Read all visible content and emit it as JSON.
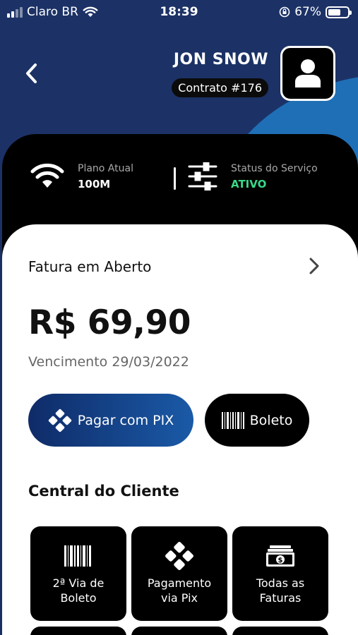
{
  "status_bar": {
    "carrier": "Claro BR",
    "time": "18:39",
    "battery": "67%",
    "battery_level": 0.67
  },
  "header": {
    "user_name": "JON SNOW",
    "contract": "Contrato #176",
    "back_icon": "chevron-left-icon",
    "avatar_icon": "user-icon"
  },
  "service_info": {
    "plan_label": "Plano Atual",
    "plan_value": "100M",
    "status_label": "Status do Serviço",
    "status_value": "ATIVO",
    "status_color": "#39d98a"
  },
  "invoice": {
    "title": "Fatura em Aberto",
    "amount": "R$ 69,90",
    "due": "Vencimento 29/03/2022"
  },
  "actions": {
    "pix_label": "Pagar com PIX",
    "boleto_label": "Boleto"
  },
  "central": {
    "title": "Central do Cliente",
    "tiles": [
      {
        "line1": "2ª Via de",
        "line2": "Boleto",
        "icon": "barcode-icon"
      },
      {
        "line1": "Pagamento",
        "line2": "via Pix",
        "icon": "pix-icon"
      },
      {
        "line1": "Todas as",
        "line2": "Faturas",
        "icon": "money-icon"
      }
    ]
  },
  "colors": {
    "header_bg": "#1c3266",
    "accent_blue": "#1f6fb6",
    "card_dark": "#000000"
  }
}
